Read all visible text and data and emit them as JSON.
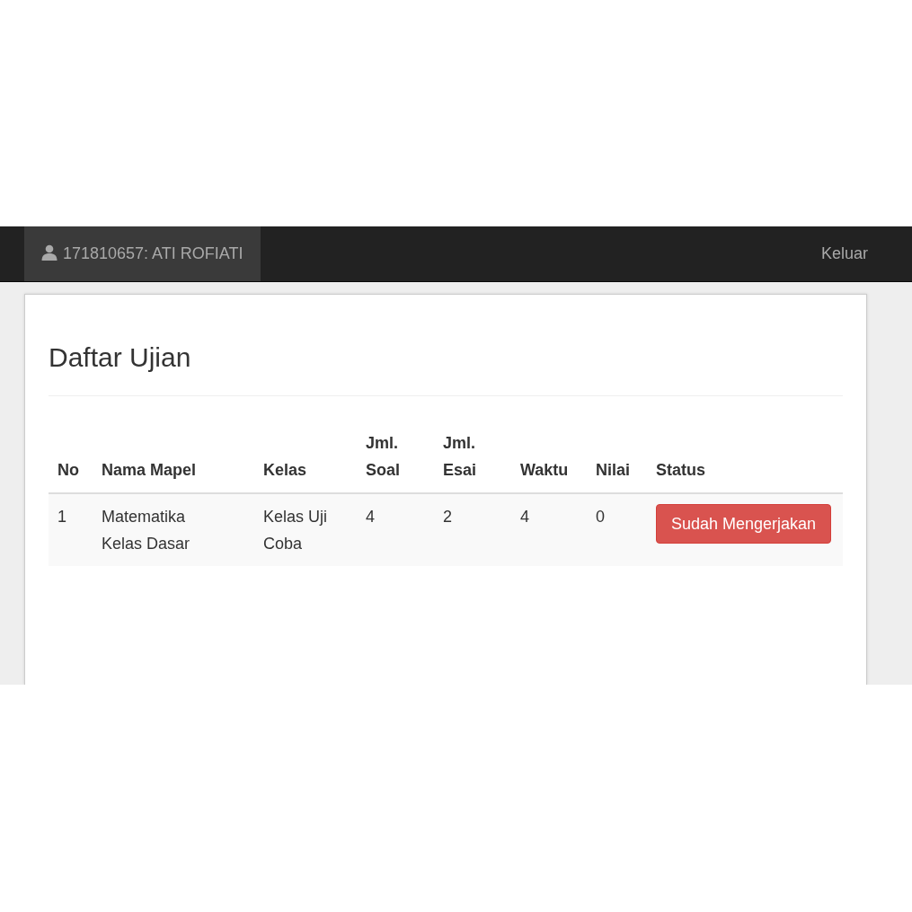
{
  "navbar": {
    "user": {
      "label": "171810657: ATI ROFIATI",
      "selected": true
    },
    "logout": {
      "label": "Keluar"
    }
  },
  "page": {
    "title": "Daftar Ujian"
  },
  "table": {
    "columns": [
      "No",
      "Nama Mapel",
      "Kelas",
      "Jml. Soal",
      "Jml. Esai",
      "Waktu",
      "Nilai",
      "Status"
    ],
    "rows": [
      {
        "no": "1",
        "nama_mapel": "Matematika Kelas Dasar",
        "kelas": "Kelas Uji Coba",
        "jml_soal": "4",
        "jml_esai": "2",
        "waktu": "4",
        "nilai": "0",
        "status": {
          "label": "Sudah Mengerjakan",
          "kind": "done"
        }
      }
    ]
  }
}
